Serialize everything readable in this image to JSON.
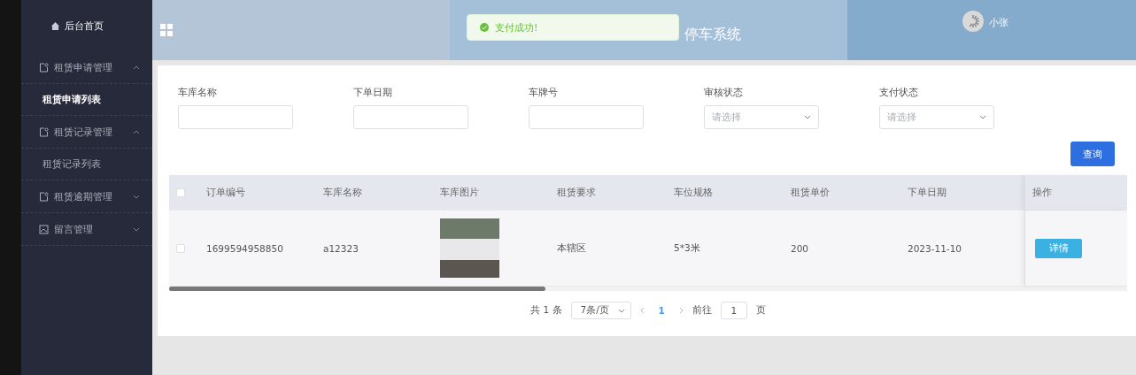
{
  "sidebar": {
    "home": "后台首页",
    "menus": [
      {
        "label": "租赁申请管理",
        "expanded": true,
        "children": [
          {
            "label": "租赁申请列表",
            "selected": true
          }
        ]
      },
      {
        "label": "租赁记录管理",
        "expanded": true,
        "children": [
          {
            "label": "租赁记录列表",
            "selected": false
          }
        ]
      },
      {
        "label": "租赁逾期管理",
        "expanded": false
      },
      {
        "label": "留言管理",
        "expanded": false
      }
    ]
  },
  "header": {
    "title": "停车系统",
    "user": "小张"
  },
  "toast": {
    "message": "支付成功!"
  },
  "filters": [
    {
      "label": "车库名称",
      "kind": "input"
    },
    {
      "label": "下单日期",
      "kind": "input"
    },
    {
      "label": "车牌号",
      "kind": "input"
    },
    {
      "label": "审核状态",
      "kind": "select",
      "placeholder": "请选择"
    },
    {
      "label": "支付状态",
      "kind": "select",
      "placeholder": "请选择"
    }
  ],
  "search_button": "查询",
  "table": {
    "header_checked": false,
    "columns": [
      "订单编号",
      "车库名称",
      "车库图片",
      "租赁要求",
      "车位规格",
      "租赁单价",
      "下单日期",
      "操作"
    ],
    "rows": [
      {
        "checked": false,
        "order_no": "1699594958850",
        "garage": "a12323",
        "requirement": "本辖区",
        "spec": "5*3米",
        "price": "200",
        "date": "2023-11-10",
        "action": "详情"
      }
    ]
  },
  "pagination": {
    "total": "共 1 条",
    "page_size": "7条/页",
    "pages": [
      {
        "label": "1",
        "selected": true
      }
    ],
    "goto_label": "前往",
    "goto_value": "1",
    "page_suffix": "页"
  }
}
